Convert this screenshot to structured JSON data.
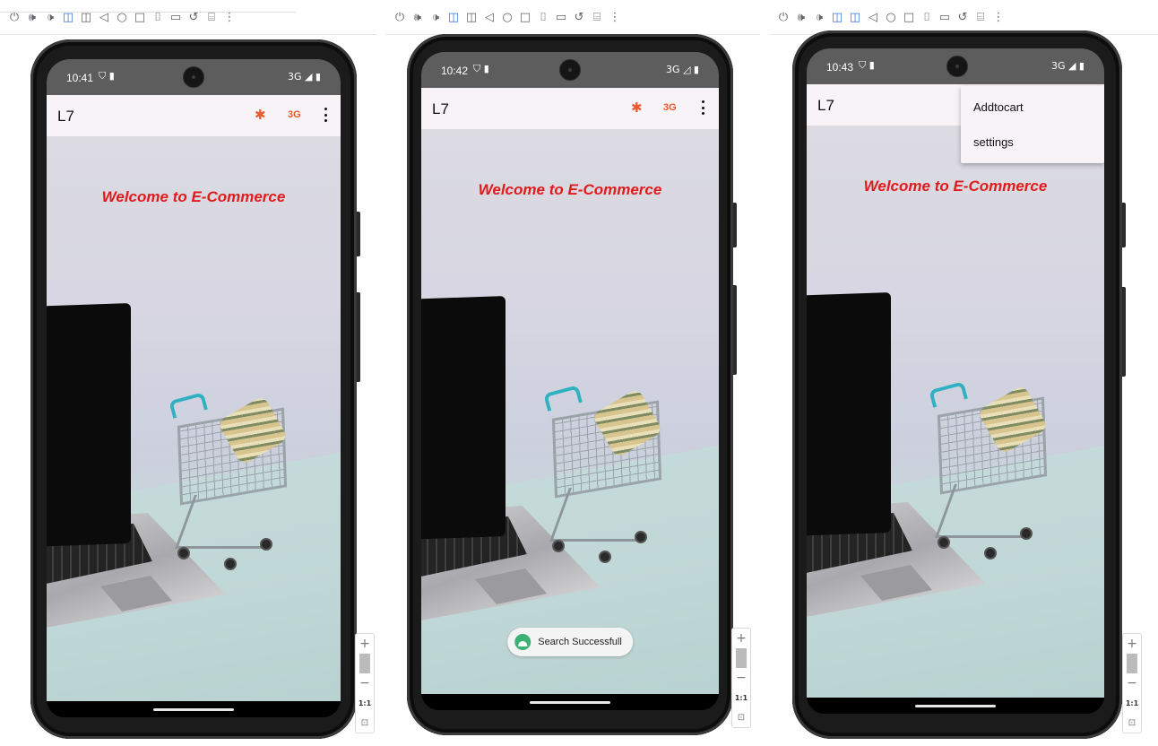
{
  "emulator_toolbar": {
    "icons": [
      "power-icon",
      "volume-up-icon",
      "volume-down-icon",
      "rotate-left-icon",
      "rotate-right-icon",
      "back-icon",
      "home-icon",
      "overview-icon",
      "screenshot-icon",
      "record-icon",
      "rewind-icon",
      "fold-icon",
      "more-icon"
    ],
    "glyphs": [
      "⏻",
      "🕪",
      "🕩",
      "◫",
      "◫",
      "◁",
      "○",
      "□",
      "⌷",
      "▭",
      "↺",
      "⌸",
      "⋮"
    ]
  },
  "zoom_controls": {
    "zoom_in": "+",
    "zoom_out": "−",
    "actual_size": "1:1",
    "fit": "⊡"
  },
  "screens": [
    {
      "status_bar": {
        "time": "10:41",
        "network": "3G"
      },
      "app_bar": {
        "title": "L7",
        "bluetooth_icon": "bluetooth-icon",
        "network_label": "3G"
      },
      "content": {
        "heading": "Welcome to E-Commerce"
      }
    },
    {
      "status_bar": {
        "time": "10:42",
        "network": "3G"
      },
      "app_bar": {
        "title": "L7",
        "bluetooth_icon": "bluetooth-icon",
        "network_label": "3G"
      },
      "content": {
        "heading": "Welcome to E-Commerce"
      },
      "toast": {
        "text": "Search Successfull"
      }
    },
    {
      "status_bar": {
        "time": "10:43",
        "network": "3G"
      },
      "app_bar": {
        "title": "L7"
      },
      "content": {
        "heading": "Welcome to E-Commerce"
      },
      "overflow_menu": {
        "items": [
          "Addtocart",
          "settings"
        ]
      }
    }
  ]
}
